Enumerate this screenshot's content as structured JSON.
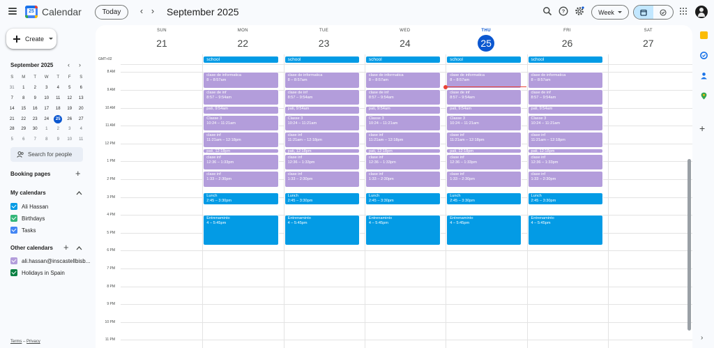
{
  "app": {
    "title": "Calendar",
    "logo_day": "25"
  },
  "header": {
    "today_label": "Today",
    "period_title": "September 2025",
    "view_selector": "Week",
    "icons": [
      "menu-icon",
      "search-icon",
      "help-icon",
      "settings-icon",
      "apps-icon"
    ]
  },
  "sidebar": {
    "create_label": "Create",
    "mini_cal": {
      "title": "September 2025",
      "dow": [
        "S",
        "M",
        "T",
        "W",
        "T",
        "F",
        "S"
      ],
      "weeks": [
        [
          "31",
          "1",
          "2",
          "3",
          "4",
          "5",
          "6"
        ],
        [
          "7",
          "8",
          "9",
          "10",
          "11",
          "12",
          "13"
        ],
        [
          "14",
          "15",
          "16",
          "17",
          "18",
          "19",
          "20"
        ],
        [
          "21",
          "22",
          "23",
          "24",
          "25",
          "26",
          "27"
        ],
        [
          "28",
          "29",
          "30",
          "1",
          "2",
          "3",
          "4"
        ],
        [
          "5",
          "6",
          "7",
          "8",
          "9",
          "10",
          "11"
        ]
      ],
      "today": "25"
    },
    "search_people": "Search for people",
    "booking_pages": "Booking pages",
    "my_calendars_title": "My calendars",
    "my_calendars": [
      {
        "name": "Ali Hassan",
        "color": "#039be5"
      },
      {
        "name": "Birthdays",
        "color": "#33b679"
      },
      {
        "name": "Tasks",
        "color": "#4285f4"
      }
    ],
    "other_calendars_title": "Other calendars",
    "other_calendars": [
      {
        "name": "ali.hassan@inscastellbisb...",
        "color": "#b39ddb"
      },
      {
        "name": "Holidays in Spain",
        "color": "#0b8043"
      }
    ],
    "footer": {
      "terms": "Terms",
      "sep": "–",
      "privacy": "Privacy"
    }
  },
  "week": {
    "timezone": "GMT+02",
    "days": [
      {
        "dow": "SUN",
        "num": "21",
        "today": false
      },
      {
        "dow": "MON",
        "num": "22",
        "today": false
      },
      {
        "dow": "TUE",
        "num": "23",
        "today": false
      },
      {
        "dow": "WED",
        "num": "24",
        "today": false
      },
      {
        "dow": "THU",
        "num": "25",
        "today": true
      },
      {
        "dow": "FRI",
        "num": "26",
        "today": false
      },
      {
        "dow": "SAT",
        "num": "27",
        "today": false
      }
    ],
    "hours": [
      "8 AM",
      "9 AM",
      "10 AM",
      "11 AM",
      "12 PM",
      "1 PM",
      "2 PM",
      "3 PM",
      "4 PM",
      "5 PM",
      "6 PM",
      "7 PM",
      "8 PM",
      "9 PM",
      "10 PM",
      "11 PM"
    ],
    "allday_event": "school",
    "weekday_events": [
      {
        "title": "clase de informatica",
        "time": "8 – 8:57am",
        "color": "purple",
        "start": 8.0,
        "end": 8.95
      },
      {
        "title": "clase de inf",
        "time": "8:57 – 9:54am",
        "color": "purple",
        "start": 8.95,
        "end": 9.9
      },
      {
        "title": "pati,",
        "time": "9:54am",
        "color": "purple",
        "start": 9.9,
        "end": 10.4,
        "short": true
      },
      {
        "title": "Classe 3",
        "time": "10:24 – 11:21am",
        "color": "purple",
        "start": 10.4,
        "end": 11.35
      },
      {
        "title": "clase inf",
        "time": "11:21am – 12:18pm",
        "color": "purple",
        "start": 11.35,
        "end": 12.3
      },
      {
        "title": "pati,",
        "time": "12:18pm",
        "color": "purple",
        "start": 12.3,
        "end": 12.6,
        "short": true
      },
      {
        "title": "clase inf",
        "time": "12:36 – 1:33pm",
        "color": "purple",
        "start": 12.6,
        "end": 13.55
      },
      {
        "title": "clase inf",
        "time": "1:33 – 2:30pm",
        "color": "purple",
        "start": 13.55,
        "end": 14.5
      },
      {
        "title": "Lunch",
        "time": "2:45 – 3:30pm",
        "color": "blue",
        "start": 14.75,
        "end": 15.5
      },
      {
        "title": "Entrenaminto",
        "time": "4 – 5:45pm",
        "color": "blue",
        "start": 16.0,
        "end": 17.75
      }
    ],
    "current_time": 8.8
  }
}
